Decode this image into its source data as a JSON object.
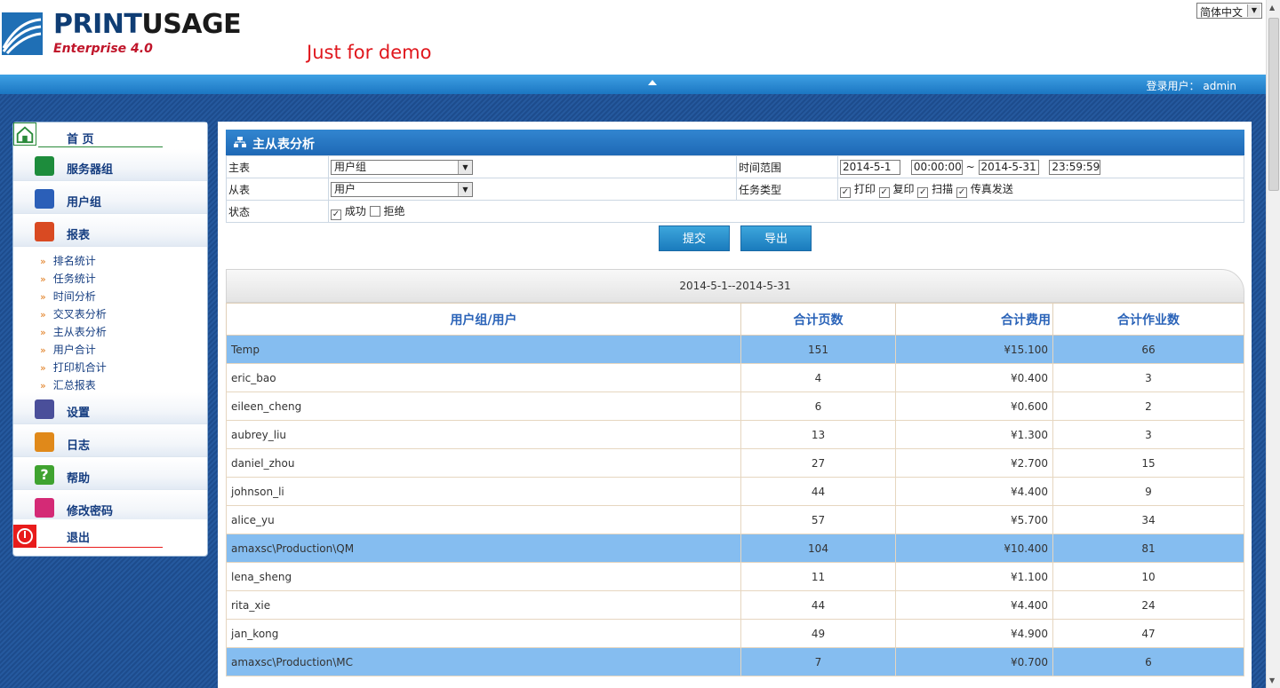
{
  "header": {
    "logo_primary": "PRINT",
    "logo_accent": "USAGE",
    "logo_sub": "Enterprise 4.0",
    "demo_text": "Just for demo",
    "language": "简体中文",
    "login_label": "登录用户：",
    "login_user": "admin"
  },
  "sidebar": {
    "home": "首 页",
    "items": [
      {
        "label": "服务器组",
        "icon": "server-group-icon"
      },
      {
        "label": "用户组",
        "icon": "user-group-icon"
      },
      {
        "label": "报表",
        "icon": "report-icon"
      }
    ],
    "report_sub": [
      "排名统计",
      "任务统计",
      "时间分析",
      "交叉表分析",
      "主从表分析",
      "用户合计",
      "打印机合计",
      "汇总报表"
    ],
    "items2": [
      {
        "label": "设置",
        "icon": "settings-icon"
      },
      {
        "label": "日志",
        "icon": "log-icon"
      },
      {
        "label": "帮助",
        "icon": "help-icon"
      },
      {
        "label": "修改密码",
        "icon": "key-icon"
      }
    ],
    "exit": "退出"
  },
  "panel": {
    "title": "主从表分析",
    "master_label": "主表",
    "master_value": "用户组",
    "detail_label": "从表",
    "detail_value": "用户",
    "status_label": "状态",
    "status_success": "成功",
    "status_reject": "拒绝",
    "time_label": "时间范围",
    "start_date": "2014-5-1",
    "start_time": "00:00:00",
    "tilde": "~",
    "end_date": "2014-5-31",
    "end_time": "23:59:59",
    "task_label": "任务类型",
    "task_print": "打印",
    "task_copy": "复印",
    "task_scan": "扫描",
    "task_fax": "传真发送",
    "submit": "提交",
    "export": "导出",
    "range_text": "2014-5-1--2014-5-31"
  },
  "table": {
    "headers": [
      "用户组/用户",
      "合计页数",
      "合计费用",
      "合计作业数"
    ],
    "rows": [
      {
        "name": "Temp",
        "pages": "151",
        "cost": "¥15.100",
        "jobs": "66",
        "group": true
      },
      {
        "name": "eric_bao",
        "pages": "4",
        "cost": "¥0.400",
        "jobs": "3",
        "group": false
      },
      {
        "name": "eileen_cheng",
        "pages": "6",
        "cost": "¥0.600",
        "jobs": "2",
        "group": false
      },
      {
        "name": "aubrey_liu",
        "pages": "13",
        "cost": "¥1.300",
        "jobs": "3",
        "group": false
      },
      {
        "name": "daniel_zhou",
        "pages": "27",
        "cost": "¥2.700",
        "jobs": "15",
        "group": false
      },
      {
        "name": "johnson_li",
        "pages": "44",
        "cost": "¥4.400",
        "jobs": "9",
        "group": false
      },
      {
        "name": "alice_yu",
        "pages": "57",
        "cost": "¥5.700",
        "jobs": "34",
        "group": false
      },
      {
        "name": "amaxsc\\Production\\QM",
        "pages": "104",
        "cost": "¥10.400",
        "jobs": "81",
        "group": true
      },
      {
        "name": "lena_sheng",
        "pages": "11",
        "cost": "¥1.100",
        "jobs": "10",
        "group": false
      },
      {
        "name": "rita_xie",
        "pages": "44",
        "cost": "¥4.400",
        "jobs": "24",
        "group": false
      },
      {
        "name": "jan_kong",
        "pages": "49",
        "cost": "¥4.900",
        "jobs": "47",
        "group": false
      },
      {
        "name": "amaxsc\\Production\\MC",
        "pages": "7",
        "cost": "¥0.700",
        "jobs": "6",
        "group": true
      }
    ]
  }
}
